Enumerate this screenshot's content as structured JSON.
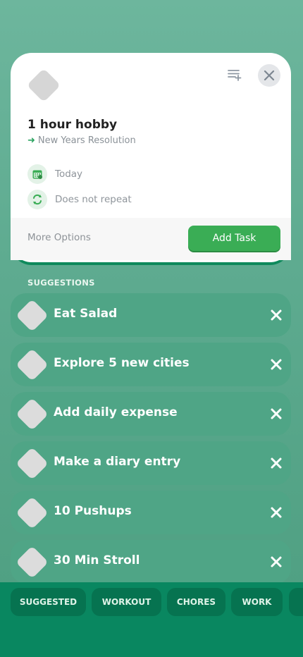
{
  "task": {
    "title": "1 hour hobby",
    "goal": "New Years Resolution",
    "date": "Today",
    "repeat": "Does not repeat",
    "more_options": "More Options",
    "add_button": "Add Task"
  },
  "suggestions": {
    "heading": "SUGGESTIONS",
    "items": [
      {
        "label": "Eat Salad"
      },
      {
        "label": "Explore 5 new cities"
      },
      {
        "label": "Add daily expense"
      },
      {
        "label": "Make a diary entry"
      },
      {
        "label": "10 Pushups"
      },
      {
        "label": "30 Min Stroll"
      }
    ]
  },
  "categories": [
    {
      "label": "SUGGESTED"
    },
    {
      "label": "WORKOUT"
    },
    {
      "label": "CHORES"
    },
    {
      "label": "WORK"
    }
  ],
  "colors": {
    "accent_green": "#3aad55",
    "background": "#5eab90",
    "bottom_bar": "#098760"
  }
}
